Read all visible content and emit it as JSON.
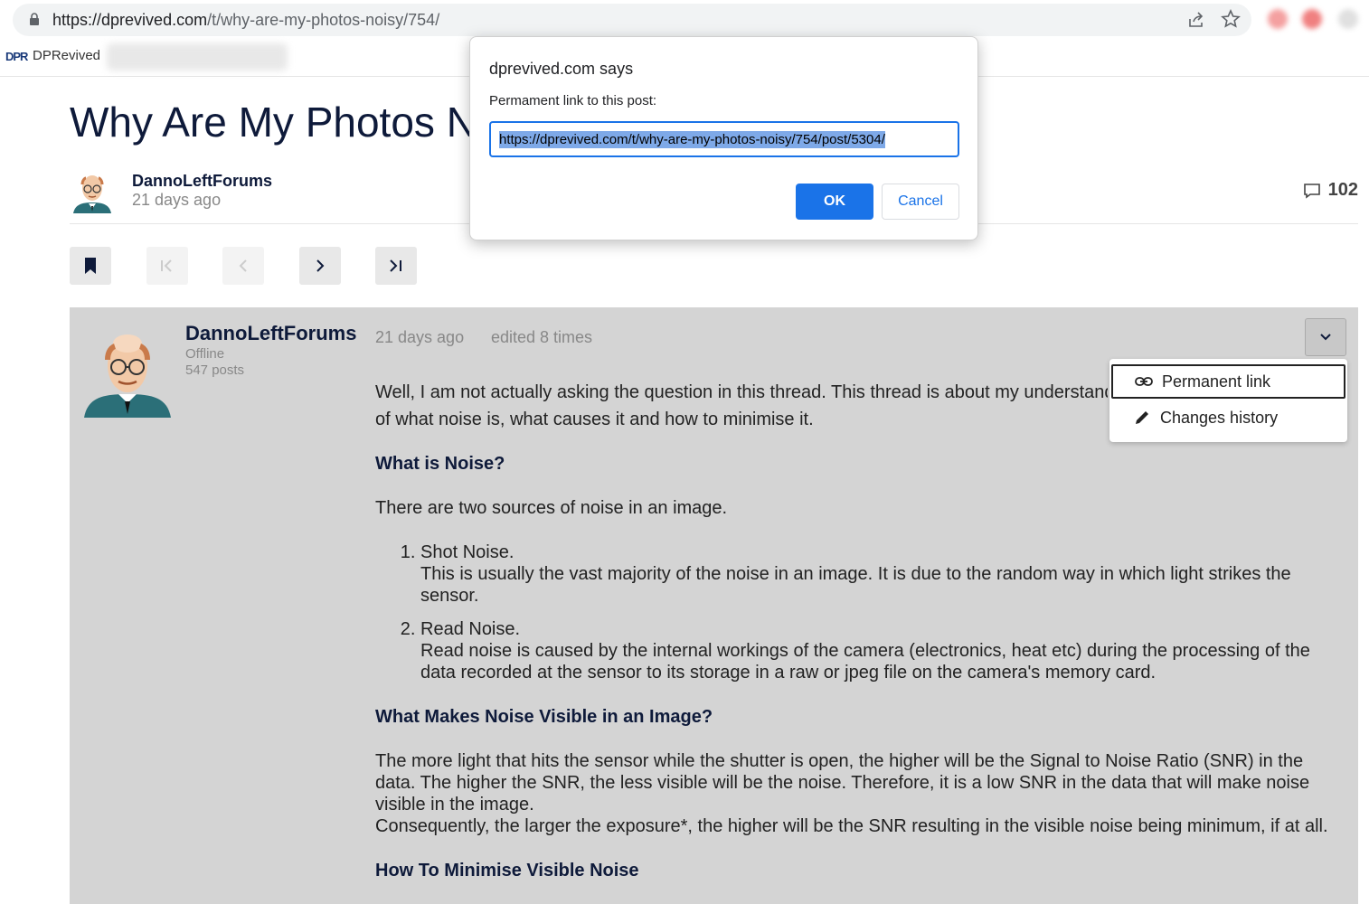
{
  "browser": {
    "url_host": "https://dprevived.com",
    "url_path": "/t/why-are-my-photos-noisy/754/",
    "bookmark_label": "DPRevived",
    "bookmark_logo": "DPR"
  },
  "topic": {
    "title": "Why Are My Photos Noisy?",
    "author": "DannoLeftForums",
    "date": "21 days ago",
    "reply_count": "102"
  },
  "post": {
    "author": "DannoLeftForums",
    "status": "Offline",
    "post_count": "547 posts",
    "date": "21 days ago",
    "edited": "edited 8 times",
    "intro_line1": "Well, I am not actually asking the question in this thread. This thread is about my understanding",
    "intro_line2": "of what noise is, what causes it and how to minimise it.",
    "h1": "What is Noise?",
    "p1": "There are two sources of noise in an image.",
    "list": [
      {
        "title": "Shot Noise.",
        "text": "This is usually the vast majority of the noise in an image. It is due to the random way in which light strikes the sensor."
      },
      {
        "title": "Read Noise.",
        "text": "Read noise is caused by the internal workings of the camera (electronics, heat etc) during the processing of the data recorded at the sensor to its storage in a raw or jpeg file on the camera's memory card."
      }
    ],
    "h2": "What Makes Noise Visible in an Image?",
    "p2": "The more light that hits the sensor while the shutter is open, the higher will be the Signal to Noise Ratio (SNR) in the data. The higher the SNR, the less visible will be the noise. Therefore, it is a low SNR in the data that will make noise visible in the image.",
    "p3": "Consequently, the larger the exposure*, the higher will be the SNR resulting in the visible noise being minimum, if at all.",
    "h3": "How To Minimise Visible Noise"
  },
  "post_menu": {
    "permalink": "Permanent link",
    "history": "Changes history"
  },
  "dialog": {
    "title": "dprevived.com says",
    "message": "Permament link to this post:",
    "value": "https://dprevived.com/t/why-are-my-photos-noisy/754/post/5304/",
    "ok": "OK",
    "cancel": "Cancel"
  },
  "colors": {
    "accent": "#1a73e8",
    "post_bg": "#d4d4d4",
    "title": "#0e1a3a"
  }
}
